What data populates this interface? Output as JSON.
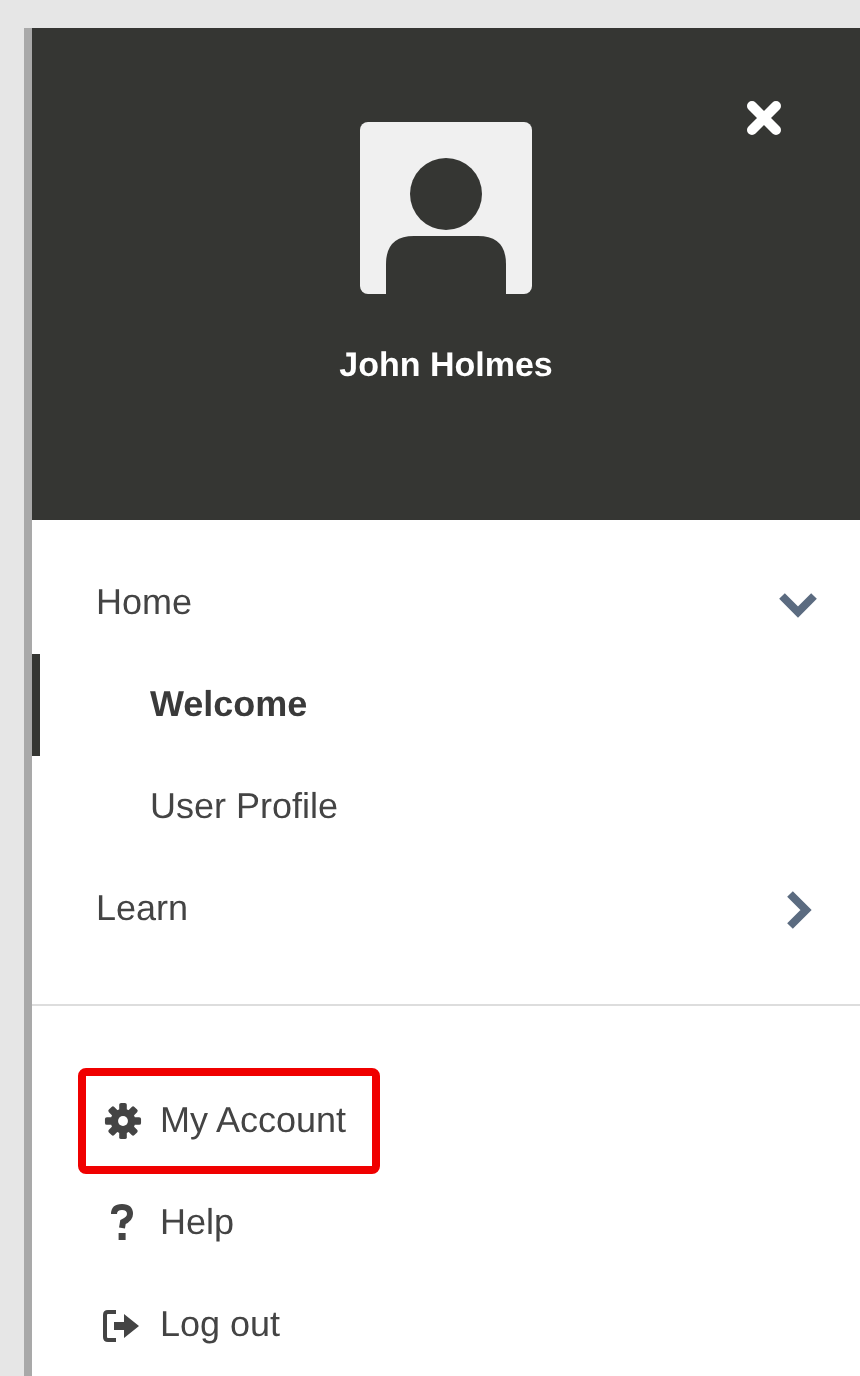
{
  "header": {
    "user_name": "John Holmes"
  },
  "menu": [
    {
      "label": "Home",
      "selected": false,
      "expanded": true,
      "children": [
        {
          "label": "Welcome",
          "selected": true
        },
        {
          "label": "User Profile",
          "selected": false
        }
      ]
    },
    {
      "label": "Learn",
      "selected": false,
      "expanded": false
    }
  ],
  "links": [
    {
      "label": "My Account",
      "kind": "settings",
      "highlighted": true
    },
    {
      "label": "Help",
      "kind": "help",
      "highlighted": false
    },
    {
      "label": "Log out",
      "kind": "logout",
      "highlighted": false
    }
  ]
}
